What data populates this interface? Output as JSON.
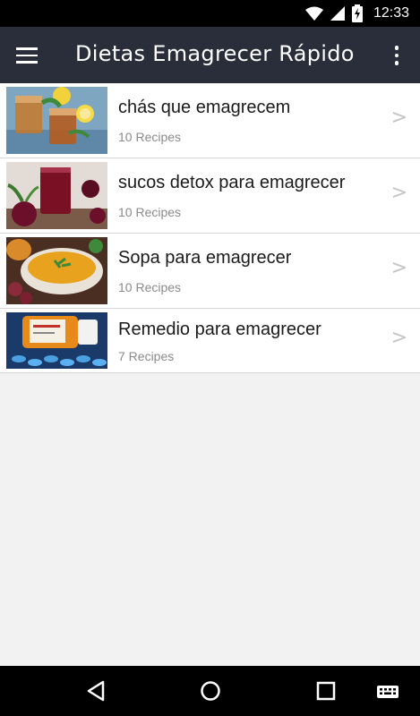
{
  "status_bar": {
    "time": "12:33",
    "icons": [
      "wifi-icon",
      "signal-icon",
      "battery-charging-icon"
    ]
  },
  "app_bar": {
    "title": "Dietas Emagrecer Rápido",
    "menu_icon": "hamburger-menu-icon",
    "overflow_icon": "more-vert-icon"
  },
  "categories": [
    {
      "title": "chás que emagrecem",
      "subtitle": "10 Recipes",
      "image": "iced-tea-lemon-image",
      "chevron": ">"
    },
    {
      "title": "sucos detox para emagrecer",
      "subtitle": "10 Recipes",
      "image": "beet-juice-image",
      "chevron": ">"
    },
    {
      "title": "Sopa para emagrecer",
      "subtitle": "10 Recipes",
      "image": "soup-bowl-image",
      "chevron": ">"
    },
    {
      "title": "Remedio para emagrecer",
      "subtitle": "7 Recipes",
      "image": "pill-bottle-image",
      "chevron": ">"
    }
  ],
  "nav_bar": {
    "icons": [
      "back-icon",
      "home-icon",
      "recents-icon",
      "keyboard-icon"
    ]
  }
}
